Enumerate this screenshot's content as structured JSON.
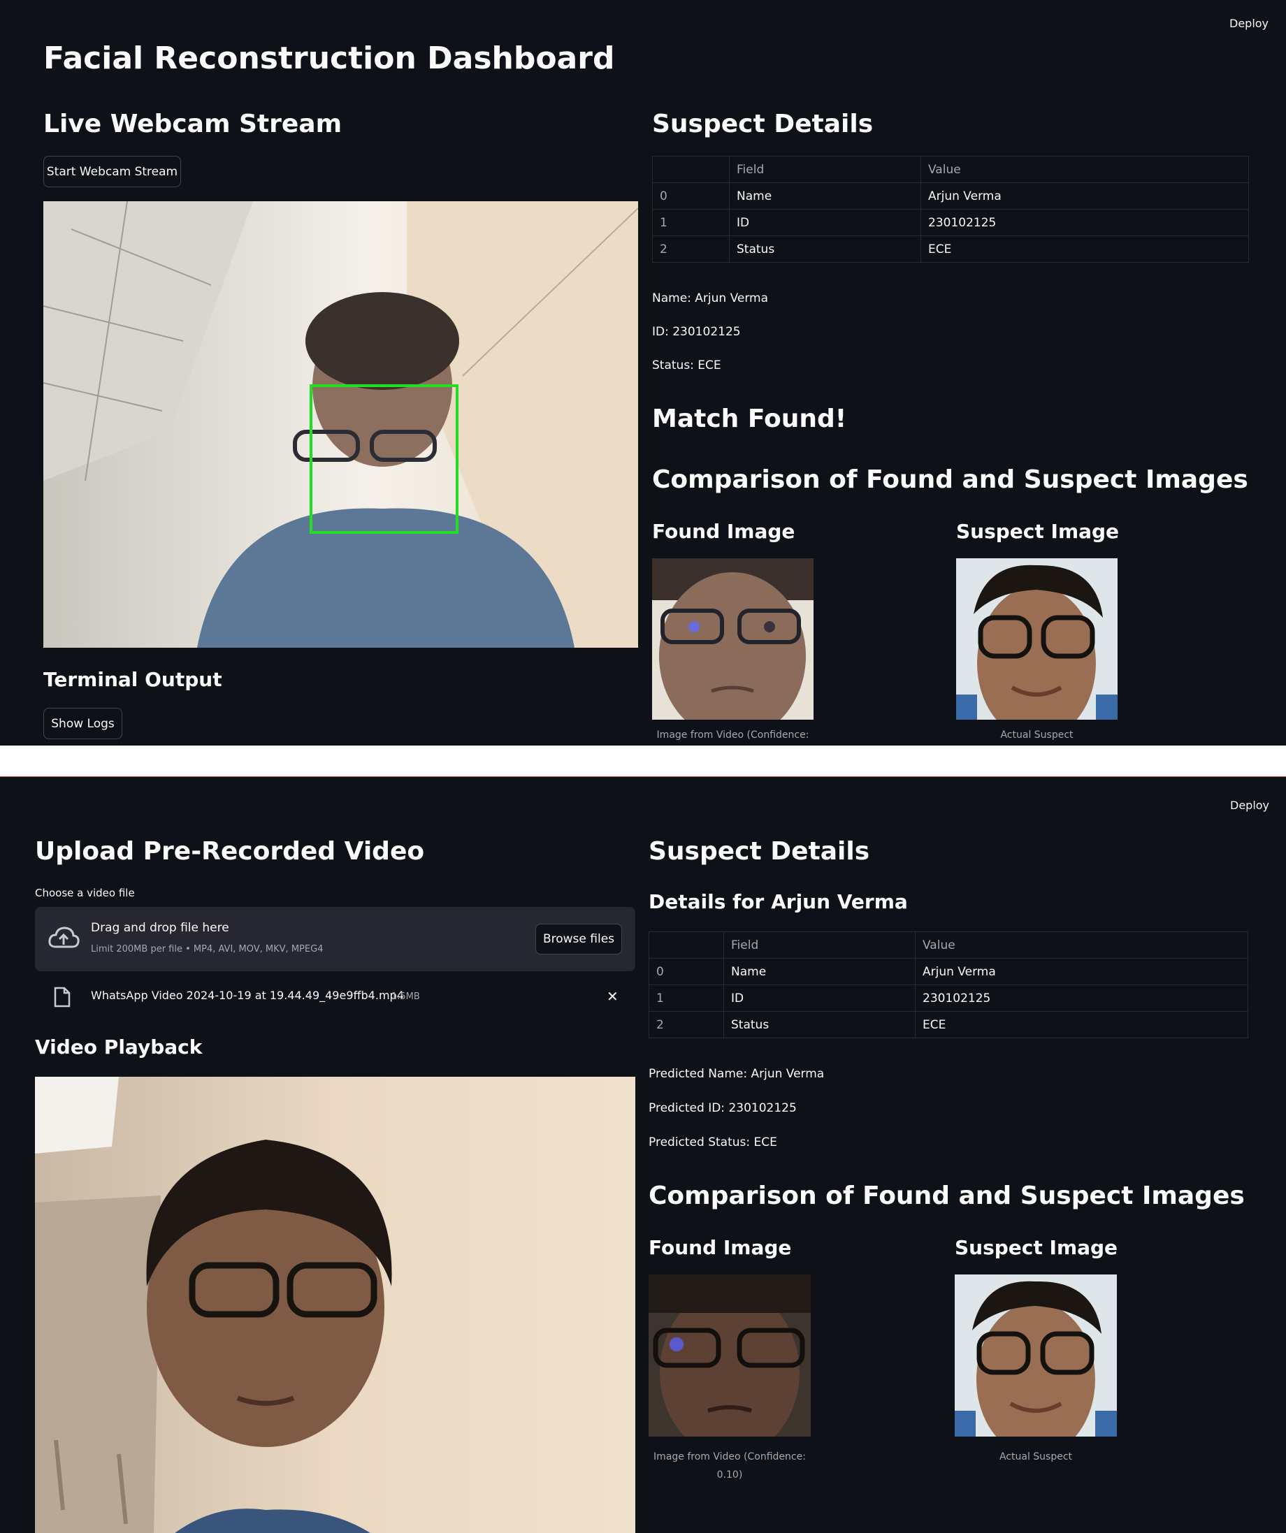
{
  "top_panel": {
    "deploy_label": "Deploy",
    "menu_glyph": "⋮",
    "page_title": "Facial Reconstruction Dashboard",
    "webcam": {
      "heading": "Live Webcam Stream",
      "start_button": "Start Webcam Stream"
    },
    "terminal": {
      "heading": "Terminal Output",
      "show_logs_button": "Show Logs"
    },
    "suspect": {
      "heading": "Suspect Details",
      "table": {
        "columns": [
          "",
          "Field",
          "Value"
        ],
        "rows": [
          {
            "index": "0",
            "field": "Name",
            "value": "Arjun Verma"
          },
          {
            "index": "1",
            "field": "ID",
            "value": "230102125"
          },
          {
            "index": "2",
            "field": "Status",
            "value": "ECE"
          }
        ]
      },
      "name_line": "Name: Arjun Verma",
      "id_line": "ID: 230102125",
      "status_line": "Status: ECE",
      "match_text": "Match Found!",
      "comparison_heading": "Comparison of Found and Suspect Images",
      "found_heading": "Found Image",
      "suspect_heading": "Suspect Image",
      "found_caption": "Image from Video (Confidence:",
      "suspect_caption": "Actual Suspect"
    }
  },
  "bottom_panel": {
    "deploy_label": "Deploy",
    "menu_glyph": "⋮",
    "upload": {
      "heading": "Upload Pre-Recorded Video",
      "label": "Choose a video file",
      "drag_text": "Drag and drop file here",
      "limit_text": "Limit 200MB per file • MP4, AVI, MOV, MKV, MPEG4",
      "browse_button": "Browse files",
      "file_name": "WhatsApp Video 2024-10-19 at 19.44.49_49e9ffb4.mp4",
      "file_size": "1.5MB",
      "remove_glyph": "✕"
    },
    "playback": {
      "heading": "Video Playback"
    },
    "suspect": {
      "heading": "Suspect Details",
      "subheading": "Details for Arjun Verma",
      "table": {
        "columns": [
          "",
          "Field",
          "Value"
        ],
        "rows": [
          {
            "index": "0",
            "field": "Name",
            "value": "Arjun Verma"
          },
          {
            "index": "1",
            "field": "ID",
            "value": "230102125"
          },
          {
            "index": "2",
            "field": "Status",
            "value": "ECE"
          }
        ]
      },
      "pred_name": "Predicted Name: Arjun Verma",
      "pred_id": "Predicted ID: 230102125",
      "pred_status": "Predicted Status: ECE",
      "comparison_heading": "Comparison of Found and Suspect Images",
      "found_heading": "Found Image",
      "suspect_heading": "Suspect Image",
      "found_caption_line1": "Image from Video (Confidence:",
      "found_caption_line2": "0.10)",
      "suspect_caption": "Actual Suspect"
    }
  },
  "colors": {
    "background": "#0e1117",
    "text": "#fafafa",
    "muted_text": "#a3a8b4",
    "uploader_bg": "#262730",
    "face_box": "#22dd22"
  }
}
